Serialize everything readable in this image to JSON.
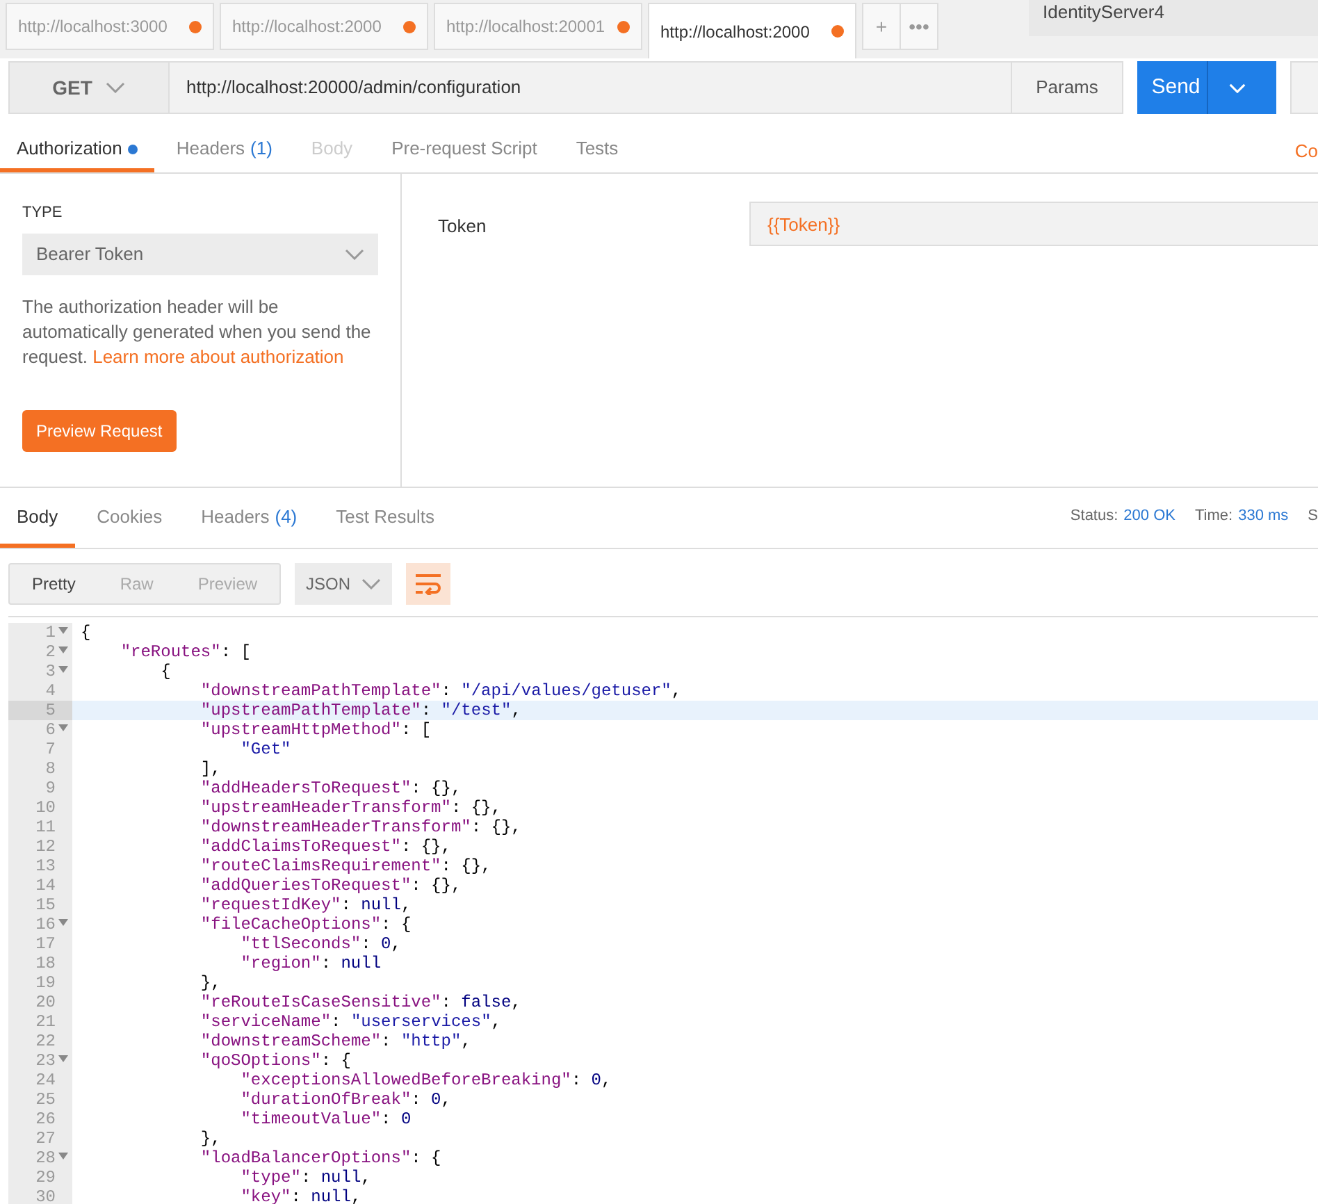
{
  "tabs": [
    {
      "label": "http://localhost:3000",
      "unsaved": true,
      "selected": false
    },
    {
      "label": "http://localhost:2000",
      "unsaved": true,
      "selected": false
    },
    {
      "label": "http://localhost:20001",
      "unsaved": true,
      "selected": false
    },
    {
      "label": "http://localhost:2000",
      "unsaved": true,
      "selected": true
    }
  ],
  "tab_actions": [
    "+",
    "•••"
  ],
  "environment": "IdentityServer4",
  "request": {
    "method": "GET",
    "url": "http://localhost:20000/admin/configuration",
    "params": "Params",
    "send": "Send"
  },
  "request_tabs": [
    {
      "label": "Authorization",
      "dot": true,
      "selected": true,
      "disabled": false
    },
    {
      "label": "Headers",
      "count": "(1)",
      "dot": false,
      "selected": false,
      "disabled": false
    },
    {
      "label": "Body",
      "dot": false,
      "selected": false,
      "disabled": true
    },
    {
      "label": "Pre-request Script",
      "dot": false,
      "selected": false,
      "disabled": false
    },
    {
      "label": "Tests",
      "dot": false,
      "selected": false,
      "disabled": false
    }
  ],
  "request_tabs_right": "Co",
  "auth": {
    "type_label": "TYPE",
    "type": "Bearer Token",
    "help": "The authorization header will be automatically generated when you send the request.",
    "help_link": "Learn more about authorization",
    "preview": "Preview Request",
    "token_label": "Token",
    "token_value": "{{Token}}"
  },
  "response_tabs": [
    {
      "label": "Body",
      "selected": true
    },
    {
      "label": "Cookies",
      "selected": false
    },
    {
      "label": "Headers",
      "count": "(4)",
      "selected": false
    },
    {
      "label": "Test Results",
      "selected": false
    }
  ],
  "response_meta": [
    {
      "label": "Status:",
      "value": "200 OK"
    },
    {
      "label": "Time:",
      "value": "330 ms"
    },
    {
      "label": "S"
    }
  ],
  "view_modes": [
    {
      "label": "Pretty",
      "selected": true
    },
    {
      "label": "Raw",
      "selected": false
    },
    {
      "label": "Preview",
      "selected": false
    }
  ],
  "format": "JSON",
  "code_lines": [
    {
      "number": "1",
      "foldable": true,
      "active": false,
      "text": "{"
    },
    {
      "number": "2",
      "foldable": true,
      "active": false,
      "text": "    \"reRoutes\": ["
    },
    {
      "number": "3",
      "foldable": true,
      "active": false,
      "text": "        {"
    },
    {
      "number": "4",
      "foldable": false,
      "active": false,
      "text": "            \"downstreamPathTemplate\": \"/api/values/getuser\","
    },
    {
      "number": "5",
      "foldable": false,
      "active": true,
      "text": "            \"upstreamPathTemplate\": \"/test\","
    },
    {
      "number": "6",
      "foldable": true,
      "active": false,
      "text": "            \"upstreamHttpMethod\": ["
    },
    {
      "number": "7",
      "foldable": false,
      "active": false,
      "text": "                \"Get\""
    },
    {
      "number": "8",
      "foldable": false,
      "active": false,
      "text": "            ],"
    },
    {
      "number": "9",
      "foldable": false,
      "active": false,
      "text": "            \"addHeadersToRequest\": {},"
    },
    {
      "number": "10",
      "foldable": false,
      "active": false,
      "text": "            \"upstreamHeaderTransform\": {},"
    },
    {
      "number": "11",
      "foldable": false,
      "active": false,
      "text": "            \"downstreamHeaderTransform\": {},"
    },
    {
      "number": "12",
      "foldable": false,
      "active": false,
      "text": "            \"addClaimsToRequest\": {},"
    },
    {
      "number": "13",
      "foldable": false,
      "active": false,
      "text": "            \"routeClaimsRequirement\": {},"
    },
    {
      "number": "14",
      "foldable": false,
      "active": false,
      "text": "            \"addQueriesToRequest\": {},"
    },
    {
      "number": "15",
      "foldable": false,
      "active": false,
      "text": "            \"requestIdKey\": null,"
    },
    {
      "number": "16",
      "foldable": true,
      "active": false,
      "text": "            \"fileCacheOptions\": {"
    },
    {
      "number": "17",
      "foldable": false,
      "active": false,
      "text": "                \"ttlSeconds\": 0,"
    },
    {
      "number": "18",
      "foldable": false,
      "active": false,
      "text": "                \"region\": null"
    },
    {
      "number": "19",
      "foldable": false,
      "active": false,
      "text": "            },"
    },
    {
      "number": "20",
      "foldable": false,
      "active": false,
      "text": "            \"reRouteIsCaseSensitive\": false,"
    },
    {
      "number": "21",
      "foldable": false,
      "active": false,
      "text": "            \"serviceName\": \"userservices\","
    },
    {
      "number": "22",
      "foldable": false,
      "active": false,
      "text": "            \"downstreamScheme\": \"http\","
    },
    {
      "number": "23",
      "foldable": true,
      "active": false,
      "text": "            \"qoSOptions\": {"
    },
    {
      "number": "24",
      "foldable": false,
      "active": false,
      "text": "                \"exceptionsAllowedBeforeBreaking\": 0,"
    },
    {
      "number": "25",
      "foldable": false,
      "active": false,
      "text": "                \"durationOfBreak\": 0,"
    },
    {
      "number": "26",
      "foldable": false,
      "active": false,
      "text": "                \"timeoutValue\": 0"
    },
    {
      "number": "27",
      "foldable": false,
      "active": false,
      "text": "            },"
    },
    {
      "number": "28",
      "foldable": true,
      "active": false,
      "text": "            \"loadBalancerOptions\": {"
    },
    {
      "number": "29",
      "foldable": false,
      "active": false,
      "text": "                \"type\": null,"
    },
    {
      "number": "30",
      "foldable": false,
      "active": false,
      "text": "                \"key\": null,"
    }
  ]
}
